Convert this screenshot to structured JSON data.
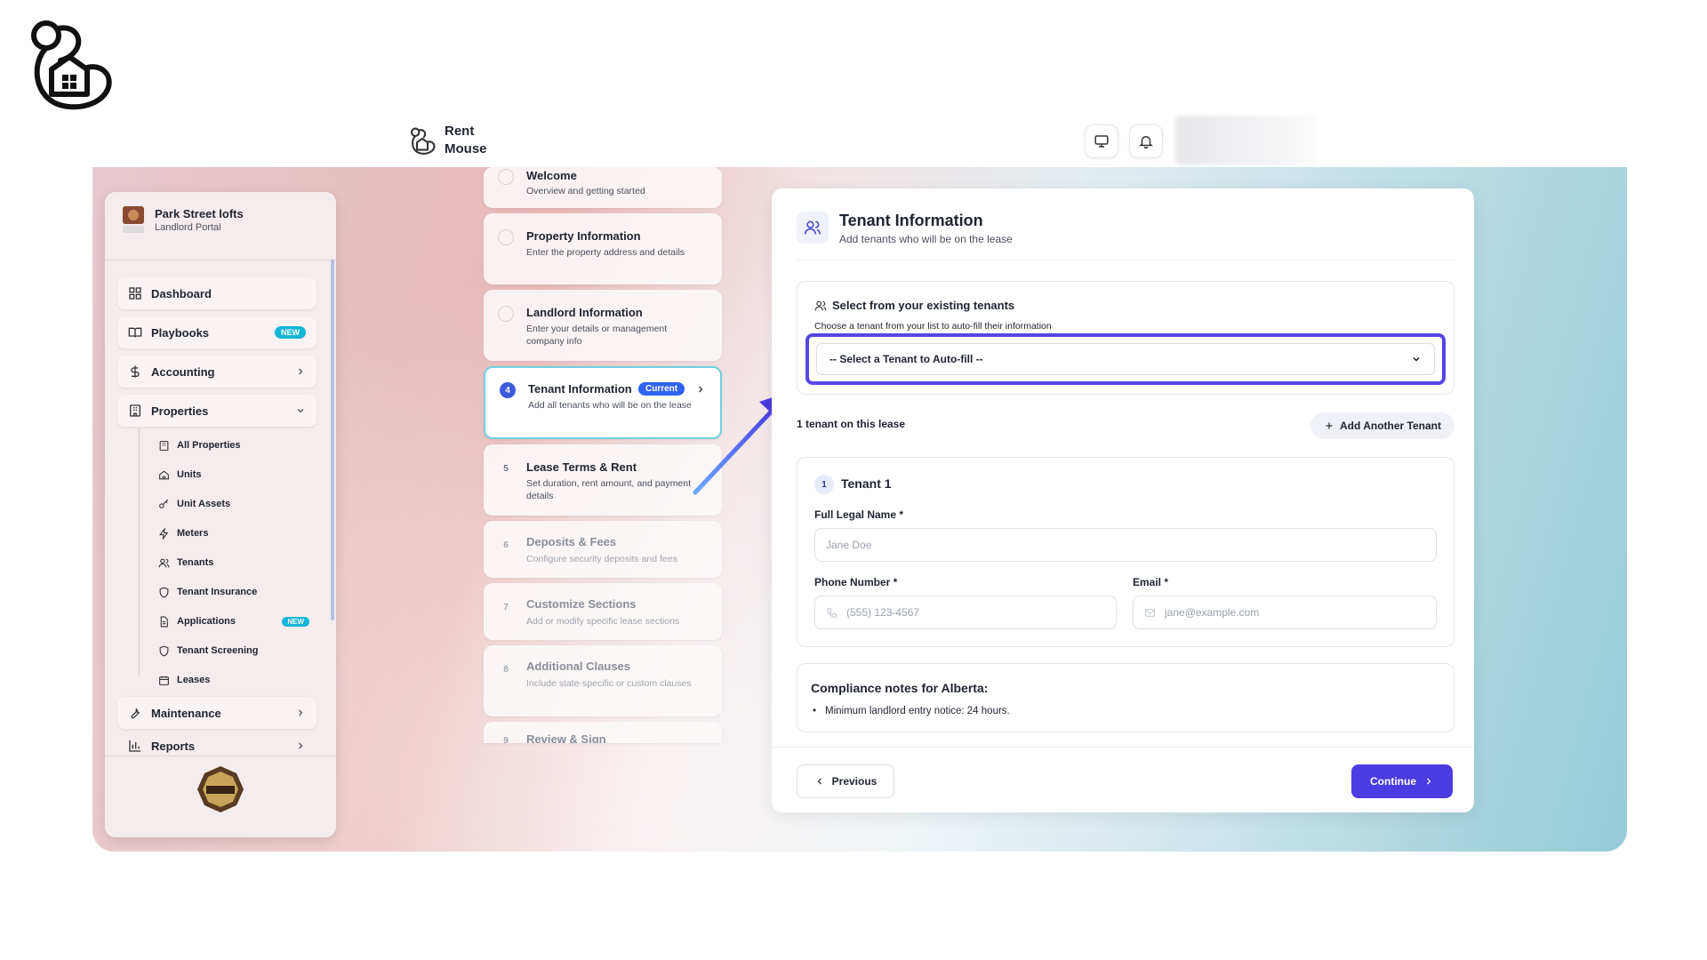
{
  "app": {
    "brand_line1": "Rent",
    "brand_line2": "Mouse"
  },
  "sidebar": {
    "org_name": "Park Street lofts",
    "org_sub": "Landlord Portal",
    "items": [
      {
        "label": "Dashboard",
        "icon": "dashboard-icon"
      },
      {
        "label": "Playbooks",
        "icon": "book-icon",
        "badge": "NEW"
      },
      {
        "label": "Accounting",
        "icon": "dollar-icon"
      },
      {
        "label": "Properties",
        "icon": "building-icon"
      },
      {
        "label": "Maintenance",
        "icon": "wrench-icon"
      },
      {
        "label": "Reports",
        "icon": "chart-icon"
      }
    ],
    "sub_items": [
      {
        "label": "All Properties",
        "icon": "building-icon"
      },
      {
        "label": "Units",
        "icon": "home-icon"
      },
      {
        "label": "Unit Assets",
        "icon": "key-icon"
      },
      {
        "label": "Meters",
        "icon": "bolt-icon"
      },
      {
        "label": "Tenants",
        "icon": "users-icon"
      },
      {
        "label": "Tenant Insurance",
        "icon": "shield-icon"
      },
      {
        "label": "Applications",
        "icon": "document-icon",
        "badge": "NEW"
      },
      {
        "label": "Tenant Screening",
        "icon": "shield-icon"
      },
      {
        "label": "Leases",
        "icon": "calendar-icon"
      }
    ]
  },
  "steps": [
    {
      "num": "",
      "title": "Welcome",
      "desc": "Overview and getting started"
    },
    {
      "num": "",
      "title": "Property Information",
      "desc": "Enter the property address and details"
    },
    {
      "num": "",
      "title": "Landlord Information",
      "desc": "Enter your details or management company info"
    },
    {
      "num": "4",
      "title": "Tenant Information",
      "desc": "Add all tenants who will be on the lease",
      "pill": "Current"
    },
    {
      "num": "5",
      "title": "Lease Terms & Rent",
      "desc": "Set duration, rent amount, and payment details"
    },
    {
      "num": "6",
      "title": "Deposits & Fees",
      "desc": "Configure security deposits and fees"
    },
    {
      "num": "7",
      "title": "Customize Sections",
      "desc": "Add or modify specific lease sections"
    },
    {
      "num": "8",
      "title": "Additional Clauses",
      "desc": "Include state-specific or custom clauses"
    },
    {
      "num": "9",
      "title": "Review & Sign",
      "desc": ""
    }
  ],
  "form": {
    "title": "Tenant Information",
    "subtitle": "Add tenants who will be on the lease",
    "existing_title": "Select from your existing tenants",
    "existing_sub": "Choose a tenant from your list to auto-fill their information",
    "select_value": "-- Select a Tenant to Auto-fill --",
    "tenant_count": "1 tenant on this lease",
    "add_tenant": "Add Another Tenant",
    "tenant_num": "1",
    "tenant_label": "Tenant 1",
    "name_label": "Full Legal Name *",
    "name_placeholder": "Jane Doe",
    "phone_label": "Phone Number *",
    "phone_placeholder": "(555) 123-4567",
    "email_label": "Email *",
    "email_placeholder": "jane@example.com",
    "compliance_title": "Compliance notes for Alberta:",
    "compliance_note": "Minimum landlord entry notice: 24 hours.",
    "prev_label": "Previous",
    "next_label": "Continue"
  },
  "colors": {
    "accent": "#4b3be0",
    "highlight": "#5546e6",
    "current_pill": "#2f63f0",
    "new_badge": "#14b5d6"
  }
}
